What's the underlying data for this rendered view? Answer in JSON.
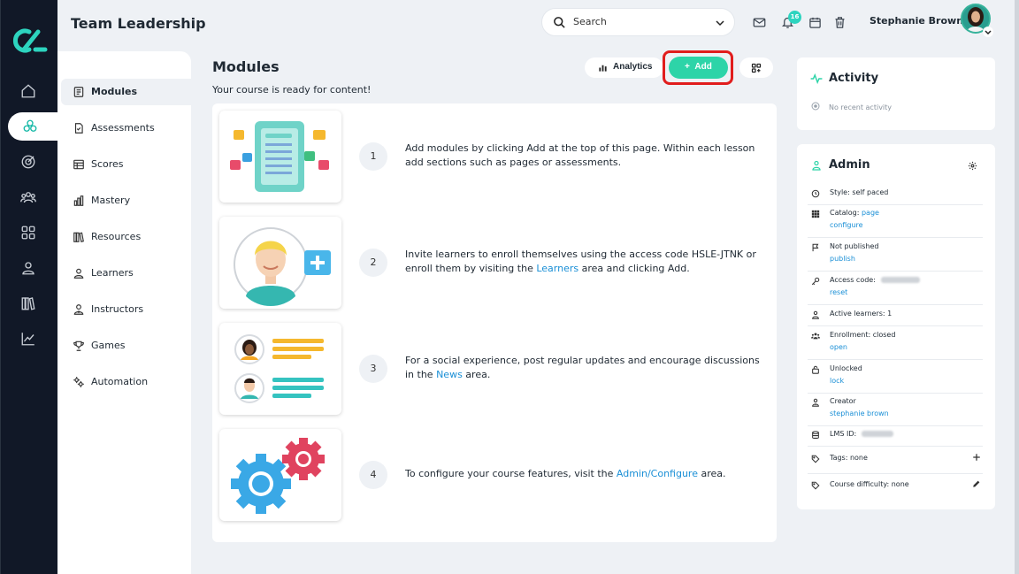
{
  "header": {
    "title": "Team Leadership",
    "search_placeholder": "Search",
    "notification_count": "16",
    "user_name": "Stephanie Brown"
  },
  "rail": {
    "items": [
      "home-icon",
      "courses-icon",
      "target-icon",
      "groups-icon",
      "apps-grid-icon",
      "profile-icon",
      "library-icon",
      "chart-icon"
    ],
    "active": "courses-icon"
  },
  "submenu": {
    "items": [
      {
        "label": "Modules",
        "icon": "book-icon",
        "active": true
      },
      {
        "label": "Assessments",
        "icon": "assessment-icon"
      },
      {
        "label": "Scores",
        "icon": "table-icon"
      },
      {
        "label": "Mastery",
        "icon": "bar-chart-icon"
      },
      {
        "label": "Resources",
        "icon": "books-icon"
      },
      {
        "label": "Learners",
        "icon": "person-icon"
      },
      {
        "label": "Instructors",
        "icon": "instructor-icon"
      },
      {
        "label": "Games",
        "icon": "trophy-icon"
      },
      {
        "label": "Automation",
        "icon": "gears-icon"
      }
    ]
  },
  "main": {
    "title": "Modules",
    "subtitle": "Your course is ready for content!",
    "analytics_label": "Analytics",
    "add_label": "Add",
    "steps": [
      {
        "num": "1",
        "text": "Add modules by clicking Add at the top of this page. Within each lesson add sections such as pages or assessments."
      },
      {
        "num": "2",
        "pre": "Invite learners to enroll themselves using the access code HSLE-JTNK or enroll them by visiting the ",
        "link": "Learners",
        "post": " area and clicking Add."
      },
      {
        "num": "3",
        "pre": "For a social experience, post regular updates and encourage discussions in the ",
        "link": "News",
        "post": " area."
      },
      {
        "num": "4",
        "pre": "To configure your course features, visit the ",
        "link": "Admin/Configure",
        "post": " area."
      }
    ]
  },
  "activity": {
    "title": "Activity",
    "empty": "No recent activity"
  },
  "admin": {
    "title": "Admin",
    "rows": [
      {
        "icon": "clock-icon",
        "label": "Style: self paced"
      },
      {
        "icon": "catalog-icon",
        "label": "Catalog: ",
        "inline_link": "page",
        "link": "configure"
      },
      {
        "icon": "flag-icon",
        "label": "Not published",
        "link": "publish"
      },
      {
        "icon": "key-icon",
        "label": "Access code:",
        "link": "reset"
      },
      {
        "icon": "person-icon",
        "label": "Active learners: 1"
      },
      {
        "icon": "group-icon",
        "label": "Enrollment: closed",
        "link": "open"
      },
      {
        "icon": "lock-icon",
        "label": "Unlocked",
        "link": "lock"
      },
      {
        "icon": "creator-icon",
        "label": "Creator",
        "link": "stephanie brown"
      },
      {
        "icon": "database-icon",
        "label": "LMS ID:"
      },
      {
        "icon": "tag-icon",
        "label": "Tags: none",
        "action": "plus-icon"
      },
      {
        "icon": "tag-icon",
        "label": "Course difficulty: none",
        "action": "pencil-icon"
      }
    ]
  },
  "colors": {
    "accent": "#2dd4a8",
    "rail": "#111827",
    "link": "#1a8fd6",
    "highlight": "#e11d1d"
  }
}
